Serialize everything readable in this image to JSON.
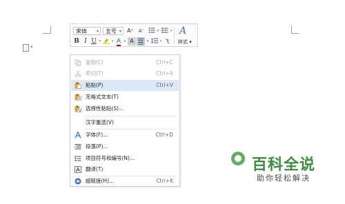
{
  "toolbar": {
    "font_name": "宋体",
    "font_size": "五号",
    "grow_font": "A⁺",
    "shrink_font": "A⁻",
    "bold": "B",
    "italic": "I",
    "underline": "U",
    "font_color": "A",
    "char_shading": "A",
    "styles_label": "样式",
    "styles_glyph": "A"
  },
  "context_menu": {
    "items": [
      {
        "label": "复制(C)",
        "shortcut": "Ctrl+C",
        "icon": "copy-icon",
        "disabled": true
      },
      {
        "label": "剪切(T)",
        "shortcut": "Ctrl+X",
        "icon": "cut-icon",
        "disabled": true
      },
      {
        "label": "粘贴(P)",
        "shortcut": "Ctrl+V",
        "icon": "paste-icon",
        "highlighted": true
      },
      {
        "label": "无格式文本(T)",
        "shortcut": "",
        "icon": "paste-plain-icon"
      },
      {
        "label": "选择性粘贴(S)...",
        "shortcut": "",
        "icon": "paste-special-icon"
      },
      {
        "label": "汉字重选(V)",
        "shortcut": "",
        "icon": ""
      },
      {
        "label": "字体(F)...",
        "shortcut": "Ctrl+D",
        "icon": "font-icon"
      },
      {
        "label": "段落(P)...",
        "shortcut": "",
        "icon": "paragraph-icon"
      },
      {
        "label": "项目符号和编号(N)...",
        "shortcut": "",
        "icon": "bullets-numbering-icon"
      },
      {
        "label": "翻译(T)",
        "shortcut": "",
        "icon": "translate-icon"
      },
      {
        "label": "超链接(H)...",
        "shortcut": "Ctrl+K",
        "icon": "hyperlink-icon"
      }
    ]
  },
  "watermark": {
    "title": "百科全说",
    "subtitle": "助你轻松解决"
  },
  "colors": {
    "highlight": "#dde8f7",
    "accent_blue": "#3a6fc4",
    "watermark_green": "#3c8f3c"
  }
}
